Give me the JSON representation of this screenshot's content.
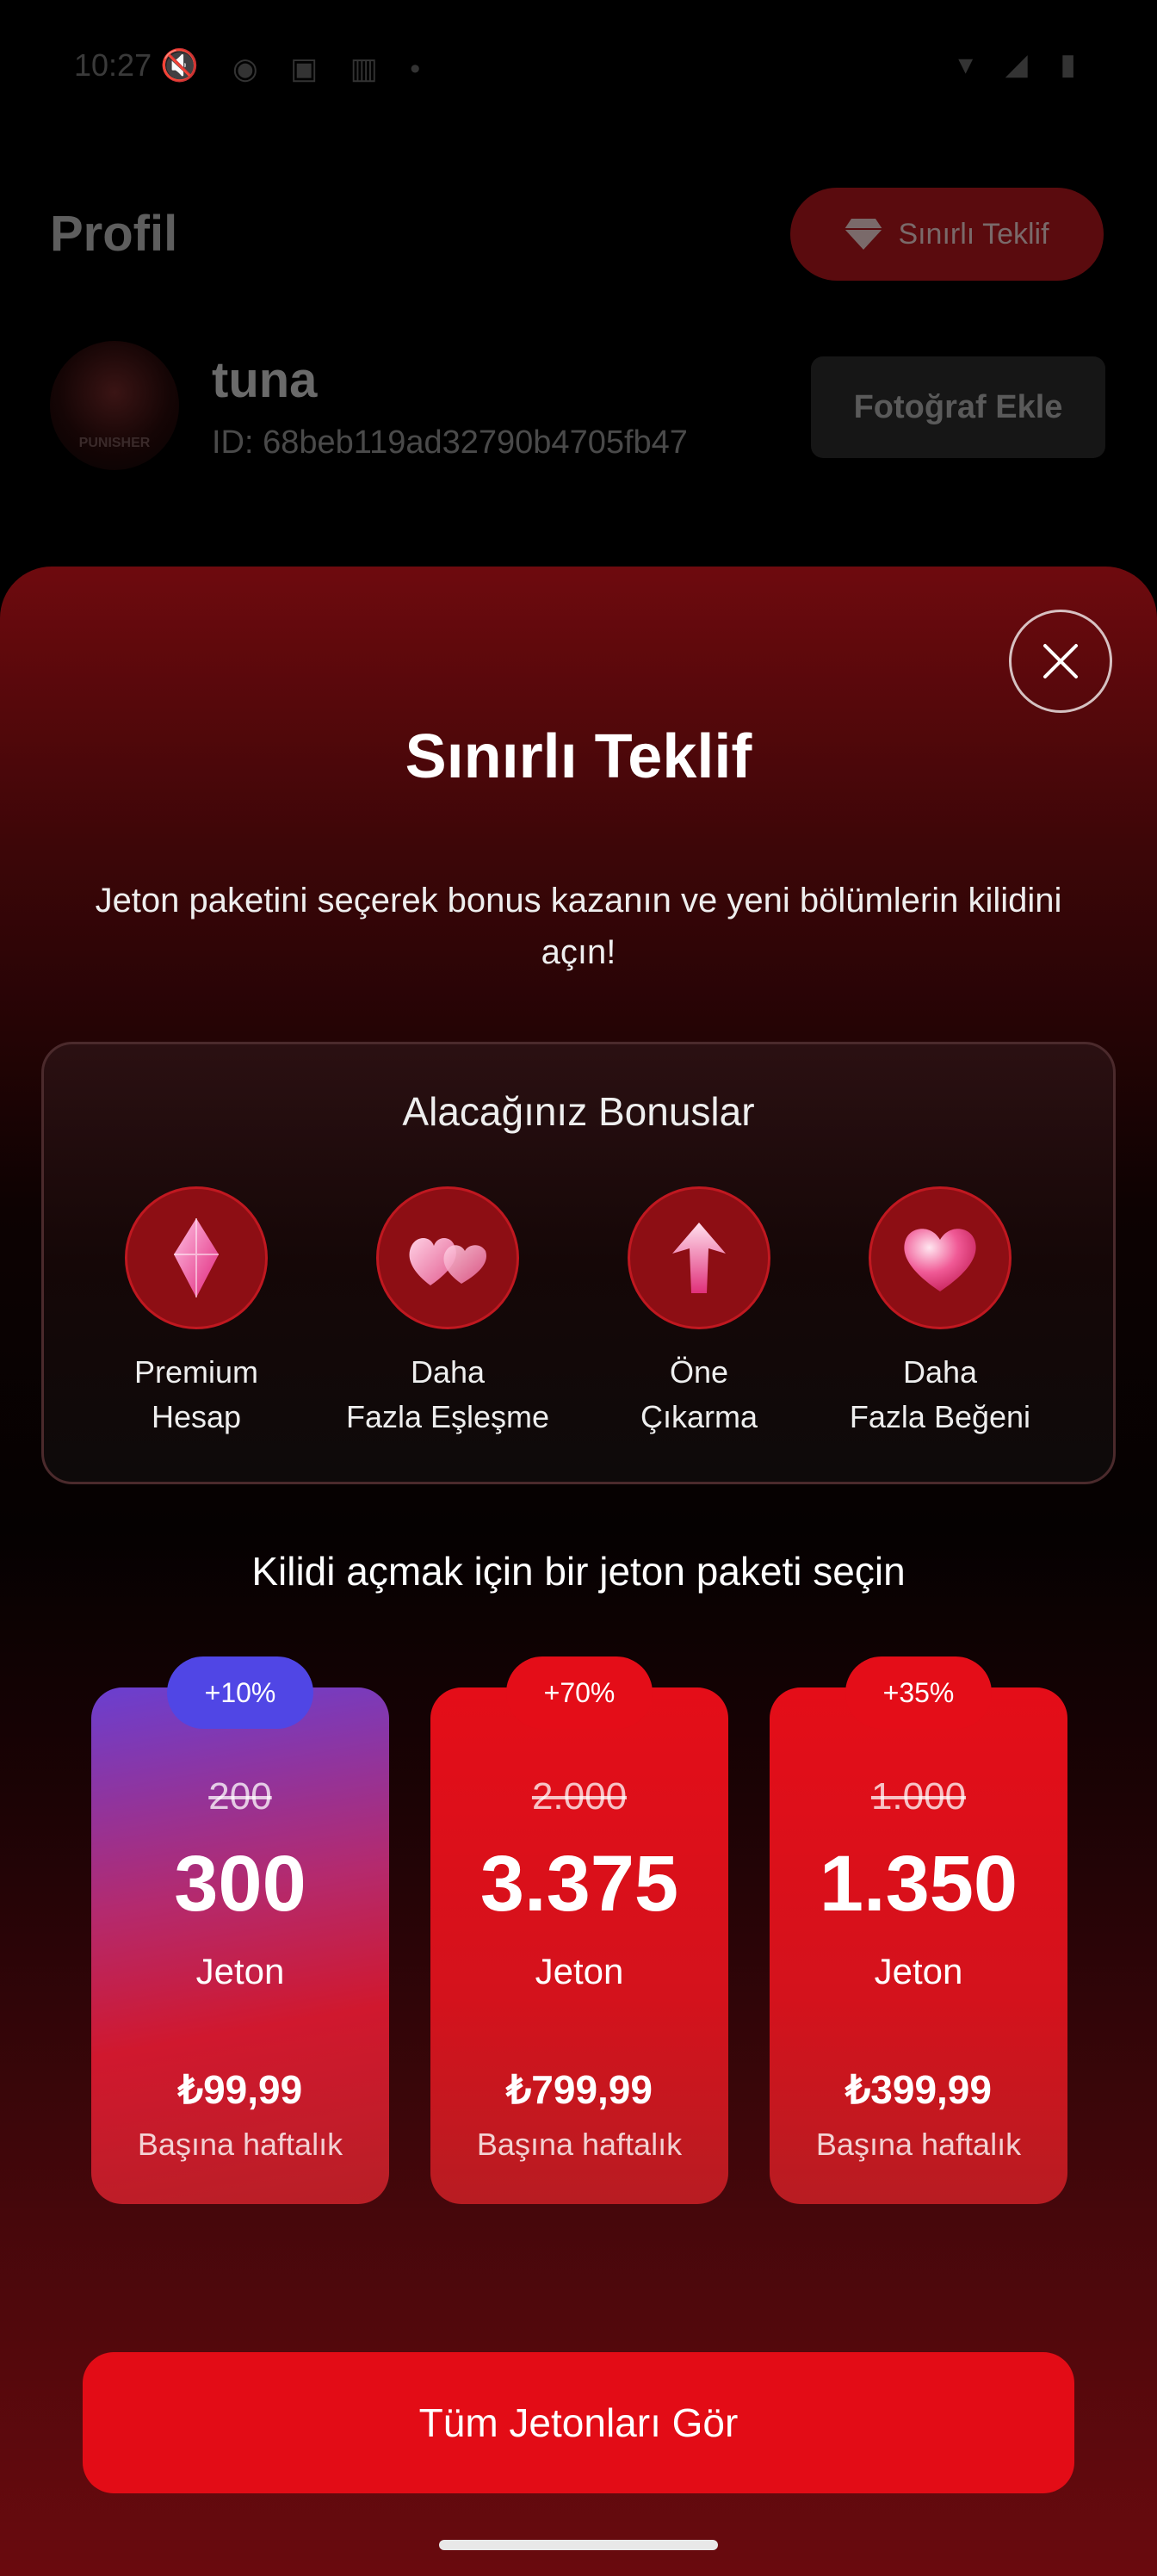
{
  "status_bar": {
    "time": "10:27 🔇",
    "icons_left": "◉ ▣ ▥ •",
    "icons_right": "▾ ◢ ▮"
  },
  "background_profile": {
    "title": "Profil",
    "limited_offer_label": "Sınırlı Teklif",
    "username": "tuna",
    "user_id": "ID: 68beb119ad32790b4705fb47",
    "avatar_text": "PUNISHER",
    "add_photo_label": "Fotoğraf Ekle"
  },
  "sheet": {
    "title": "Sınırlı Teklif",
    "subtitle": "Jeton paketini seçerek bonus kazanın ve yeni bölümlerin kilidini açın!",
    "bonus_title": "Alacağınız Bonuslar",
    "bonuses": [
      {
        "line1": "Premium",
        "line2": "Hesap",
        "icon": "diamond-icon"
      },
      {
        "line1": "Daha",
        "line2": "Fazla Eşleşme",
        "icon": "hearts-icon"
      },
      {
        "line1": "Öne",
        "line2": "Çıkarma",
        "icon": "boost-arrow-icon"
      },
      {
        "line1": "Daha",
        "line2": "Fazla Beğeni",
        "icon": "heart-icon"
      }
    ],
    "pick_title": "Kilidi açmak için bir jeton paketi seçin",
    "packages": [
      {
        "badge": "+10%",
        "old_amount": "200",
        "amount": "300",
        "unit": "Jeton",
        "price": "₺99,99",
        "period": "Başına haftalık"
      },
      {
        "badge": "+70%",
        "old_amount": "2.000",
        "amount": "3.375",
        "unit": "Jeton",
        "price": "₺799,99",
        "period": "Başına haftalık"
      },
      {
        "badge": "+35%",
        "old_amount": "1.000",
        "amount": "1.350",
        "unit": "Jeton",
        "price": "₺399,99",
        "period": "Başına haftalık"
      }
    ],
    "cta_label": "Tüm Jetonları Gör"
  },
  "colors": {
    "accent_red": "#e30c16",
    "badge_purple": "#5046e5",
    "card_gradient_start": "#6a3fd0",
    "card_gradient_end": "#c41730"
  }
}
